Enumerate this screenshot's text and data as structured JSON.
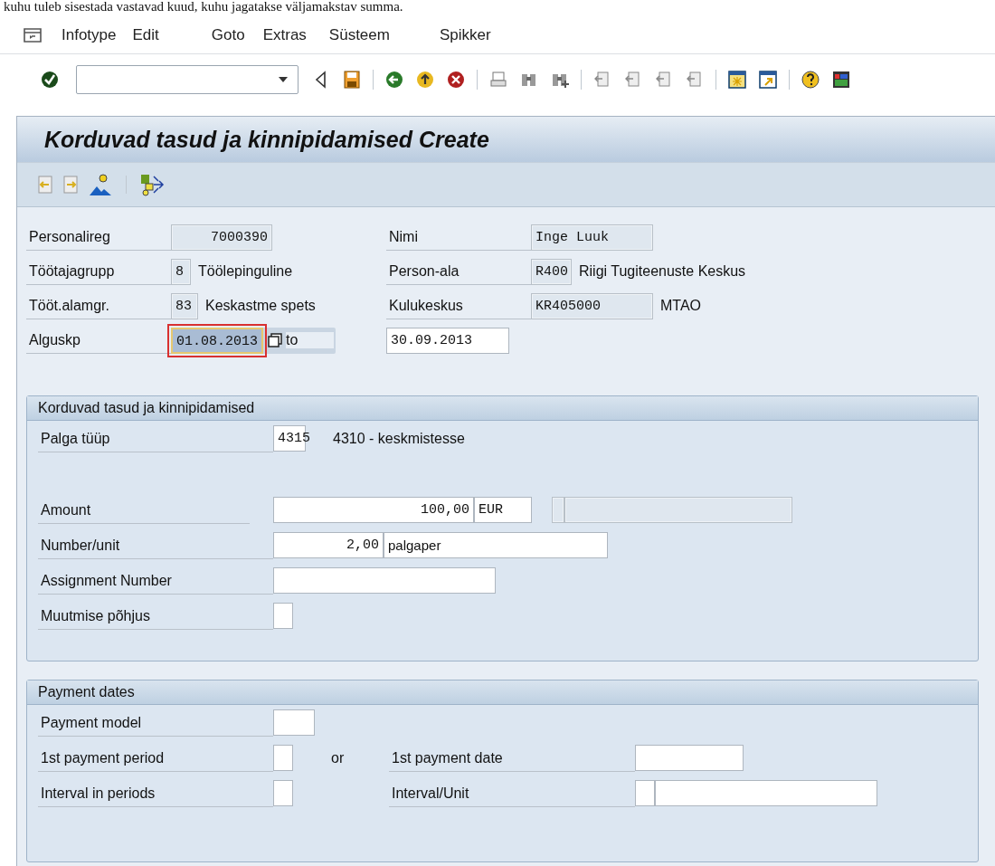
{
  "document_text": "kuhu tuleb sisestada vastavad kuud, kuhu jagatakse väljamakstav summa.",
  "menu_bar": {
    "items": [
      "Infotype",
      "Edit",
      "Goto",
      "Extras",
      "Süsteem",
      "Spikker"
    ]
  },
  "title": "Korduvad tasud ja kinnipidamised Create",
  "header": {
    "rows": [
      {
        "label": "Personalireg",
        "value": "7000390",
        "right_label": "Nimi",
        "right_value": "Inge Luuk"
      },
      {
        "label": "Töötajagrupp",
        "value": "8",
        "text": "Töölepinguline",
        "right_label": "Person-ala",
        "right_value": "R400",
        "right_text": "Riigi Tugiteenuste Keskus"
      },
      {
        "label": "Tööt.alamgr.",
        "value": "83",
        "text": "Keskastme spets",
        "right_label": "Kulukeskus",
        "right_value": "KR405000",
        "right_text": "MTAO"
      }
    ],
    "start_date": {
      "label": "Alguskp",
      "value": "01.08.2013",
      "focused": true,
      "to_label": "to",
      "end_value": "30.09.2013"
    }
  },
  "wage_section": {
    "title": "Korduvad tasud ja kinnipidamised",
    "wage_type": {
      "label": "Palga tüüp",
      "value": "4315",
      "text": "4310 - keskmistesse"
    },
    "amount": {
      "label": "Amount",
      "value": "100,00",
      "currency": "EUR"
    },
    "number": {
      "label": "Number/unit",
      "value": "2,00",
      "unit": "palgaper"
    },
    "assignment": {
      "label": "Assignment Number"
    },
    "reason": {
      "label": "Muutmise põhjus"
    }
  },
  "payment_dates": {
    "title": "Payment dates",
    "model": {
      "label": "Payment model"
    },
    "first_period": {
      "label": "1st payment period"
    },
    "or": "or",
    "first_date": {
      "label": "1st payment date"
    },
    "interval": {
      "label": "Interval in periods"
    },
    "interval_unit": {
      "label": "Interval/Unit"
    }
  }
}
